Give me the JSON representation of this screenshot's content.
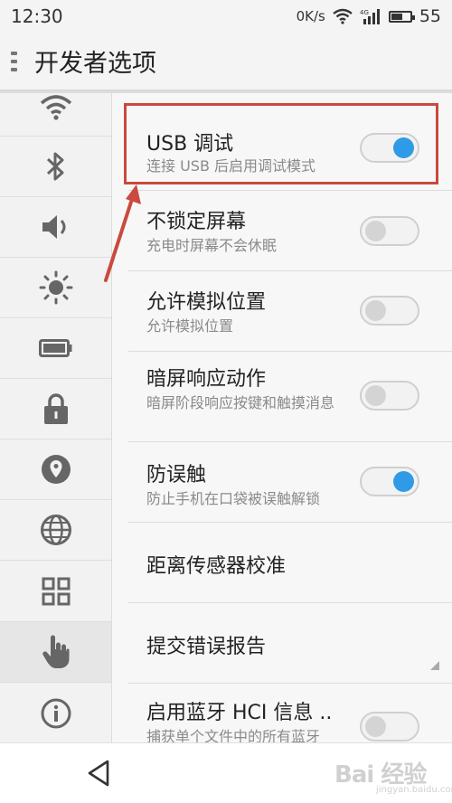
{
  "status_bar": {
    "time": "12:30",
    "network_speed": "0K/s",
    "battery": "55"
  },
  "title_bar": {
    "title": "开发者选项"
  },
  "side_rail": {
    "items": [
      {
        "icon": "wifi-icon"
      },
      {
        "icon": "bluetooth-icon"
      },
      {
        "icon": "volume-icon"
      },
      {
        "icon": "brightness-icon"
      },
      {
        "icon": "battery-icon"
      },
      {
        "icon": "lock-icon"
      },
      {
        "icon": "location-icon"
      },
      {
        "icon": "globe-icon"
      },
      {
        "icon": "apps-grid-icon"
      },
      {
        "icon": "hand-pointer-icon",
        "selected": true
      },
      {
        "icon": "info-icon"
      }
    ]
  },
  "settings": [
    {
      "title": "USB 调试",
      "subtitle": "连接 USB 后启用调试模式",
      "toggle": "on"
    },
    {
      "title": "不锁定屏幕",
      "subtitle": "充电时屏幕不会休眠",
      "toggle": "off"
    },
    {
      "title": "允许模拟位置",
      "subtitle": "允许模拟位置",
      "toggle": "off"
    },
    {
      "title": "暗屏响应动作",
      "subtitle": "暗屏阶段响应按键和触摸消息",
      "toggle": "off"
    },
    {
      "title": "防误触",
      "subtitle": "防止手机在口袋被误触解锁",
      "toggle": "on"
    },
    {
      "title": "距离传感器校准"
    },
    {
      "title": "提交错误报告"
    },
    {
      "title": "启用蓝牙 HCI 信息 ..",
      "subtitle": "捕获单个文件中的所有蓝牙",
      "toggle": "off"
    }
  ],
  "colors": {
    "toggle_on": "#2f9be6",
    "annotation": "#c94a3e"
  },
  "watermark": {
    "logo": "Bai 经验",
    "url": "jingyan.baidu.com"
  }
}
